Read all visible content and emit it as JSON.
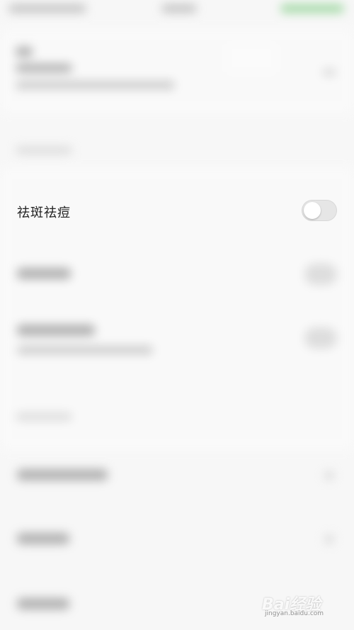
{
  "setting": {
    "label": "祛斑祛痘",
    "enabled": false
  },
  "watermark": {
    "brand": "Bai经验",
    "url": "jingyan.baidu.com"
  }
}
